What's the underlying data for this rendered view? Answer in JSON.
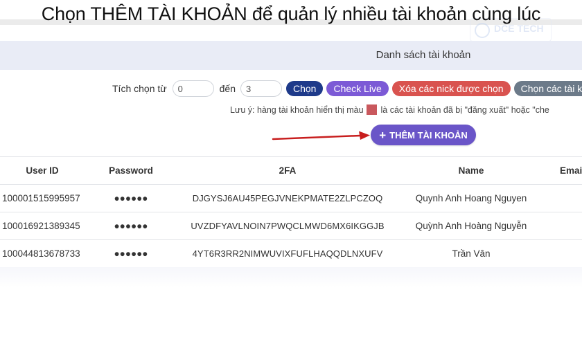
{
  "caption": "Chọn THÊM TÀI KHOẢN để quản lý nhiều tài khoản cùng lúc",
  "watermark": {
    "text": "DCE TECH"
  },
  "header": {
    "title": "Danh sách tài khoản"
  },
  "toolbar": {
    "from_label": "Tích chọn từ",
    "from_value": "0",
    "to_label": "đến",
    "to_value": "3",
    "choose_label": "Chọn",
    "check_live_label": "Check Live",
    "delete_selected_label": "Xóa các nick được chọn",
    "select_all_label": "Chọn các tài kh"
  },
  "note": {
    "before": "Lưu ý: hàng tài khoản hiển thị màu",
    "after": "là các tài khoản đã bị \"đăng xuất\" hoặc \"che"
  },
  "add_button": {
    "icon": "plus-icon",
    "label": "THÊM TÀI KHOẢN"
  },
  "table": {
    "headers": {
      "user_id": "User ID",
      "password": "Password",
      "twofa": "2FA",
      "name": "Name",
      "email": "Emai"
    },
    "rows": [
      {
        "user_id": "100001515995957",
        "password": "●●●●●●",
        "twofa": "DJGYSJ6AU45PEGJVNEKPMATE2ZLPCZOQ",
        "name": "Quynh Anh Hoang Nguyen"
      },
      {
        "user_id": "100016921389345",
        "password": "●●●●●●",
        "twofa": "UVZDFYAVLNOIN7PWQCLMWD6MX6IKGGJB",
        "name": "Quỳnh Anh Hoàng Nguyễn"
      },
      {
        "user_id": "100044813678733",
        "password": "●●●●●●",
        "twofa": "4YT6R3RR2NIMWUVIXFUFLHAQQDLNXUFV",
        "name": "Trần Vân"
      }
    ]
  },
  "colors": {
    "choose": "#1e3a8a",
    "check_live": "#7c5ad6",
    "delete_selected": "#d9534f",
    "select_all": "#6c7a89",
    "add_button": "#6a55c8",
    "logged_out_swatch": "#c9585d",
    "arrow": "#c81e1e"
  }
}
